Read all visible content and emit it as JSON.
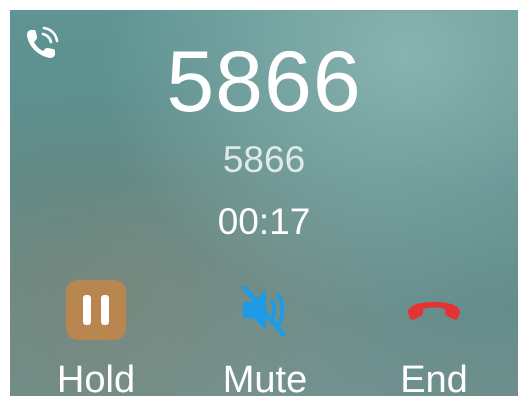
{
  "call": {
    "status_icon": "phone-ringing-icon",
    "number_display": "5866",
    "number_secondary": "5866",
    "duration": "00:17"
  },
  "actions": {
    "hold": {
      "label": "Hold",
      "icon": "pause-icon",
      "color": "#b8864e"
    },
    "mute": {
      "label": "Mute",
      "icon": "speaker-muted-icon",
      "color": "#1e9be6"
    },
    "end": {
      "label": "End",
      "icon": "hang-up-icon",
      "color": "#e53232"
    }
  }
}
